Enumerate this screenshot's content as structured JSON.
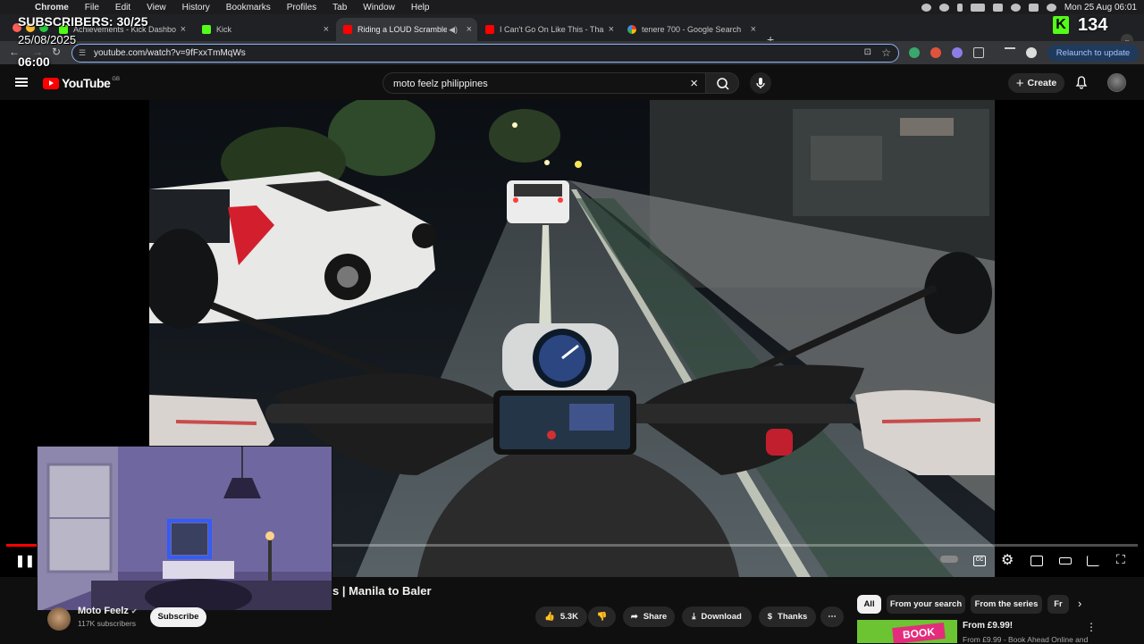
{
  "menubar": {
    "items": [
      "Chrome",
      "File",
      "Edit",
      "View",
      "History",
      "Bookmarks",
      "Profiles",
      "Tab",
      "Window",
      "Help"
    ],
    "datetime": "Mon 25 Aug 06:01"
  },
  "tabs": [
    {
      "title": "Achievements - Kick Dashbo",
      "favicon": "kick-icon"
    },
    {
      "title": "Kick",
      "favicon": "kick-icon"
    },
    {
      "title": "Riding a LOUD Scrambler",
      "favicon": "youtube-icon",
      "active": true
    },
    {
      "title": "I Can't Go On Like This - Tha",
      "favicon": "youtube-icon"
    },
    {
      "title": "tenere 700 - Google Search",
      "favicon": "google-icon"
    }
  ],
  "address_bar": {
    "url": "youtube.com/watch?v=9fFxxTmMqWs",
    "relaunch_label": "Relaunch to update"
  },
  "overlay": {
    "subscribers": "SUBSCRIBERS: 30/25",
    "date": "25/08/2025",
    "time": "06:00",
    "kick_count": "134",
    "kick_letter": "K"
  },
  "youtube": {
    "logo_text": "YouTube",
    "region": "GB",
    "search_query": "moto feelz philippines",
    "create_label": "Create"
  },
  "video": {
    "progress": 0.027,
    "title_visible": "s | Manila to Baler",
    "channel_name": "Moto Feelz",
    "channel_subs": "117K subscribers",
    "subscribe_label": "Subscribe",
    "likes": "5.3K",
    "share_label": "Share",
    "download_label": "Download",
    "thanks_label": "Thanks"
  },
  "sidebar": {
    "chips": [
      "All",
      "From your search",
      "From the series",
      "Fr"
    ],
    "rec_title": "From £9.99!",
    "rec_subtitle": "From £9.99 - Book Ahead Online and",
    "rec_thumb_text": "BOOK"
  },
  "colors": {
    "accent_red": "#ff0000",
    "kick_green": "#53fc18",
    "chrome_blue": "#8ab4f8"
  }
}
